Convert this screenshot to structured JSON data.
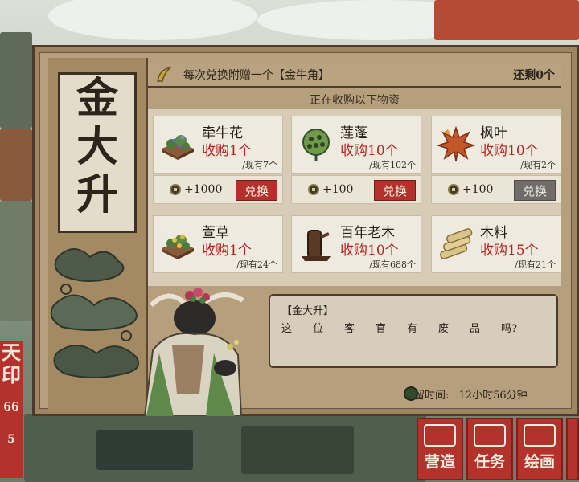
{
  "left_banner": {
    "char1": "天",
    "char2": "印",
    "number": "66",
    "char3": "5"
  },
  "merchant": {
    "name_chars": [
      "金",
      "大",
      "升"
    ]
  },
  "header": {
    "promo": "每次兑换附赠一个【金牛角】",
    "remaining": "还剩0个"
  },
  "subtitle": "正在收购以下物资",
  "items": [
    {
      "name": "牵牛花",
      "buy": "收购1个",
      "stock": "/现有7个",
      "reward": "+1000",
      "button": "兑换",
      "enabled": true,
      "icon": "morning-glory-icon"
    },
    {
      "name": "莲蓬",
      "buy": "收购10个",
      "stock": "/现有102个",
      "reward": "+100",
      "button": "兑换",
      "enabled": true,
      "icon": "lotus-pod-icon"
    },
    {
      "name": "枫叶",
      "buy": "收购10个",
      "stock": "/现有2个",
      "reward": "+100",
      "button": "兑换",
      "enabled": false,
      "icon": "maple-leaf-icon"
    },
    {
      "name": "萱草",
      "buy": "收购1个",
      "stock": "/现有24个",
      "icon": "daylily-icon"
    },
    {
      "name": "百年老木",
      "buy": "收购10个",
      "stock": "/现有688个",
      "icon": "old-wood-icon"
    },
    {
      "name": "木料",
      "buy": "收购15个",
      "stock": "/现有21个",
      "icon": "lumber-icon"
    }
  ],
  "dialog": {
    "speaker": "【金大升】",
    "line": "这——位——客——官——有——废——品——吗?"
  },
  "stay": {
    "label": "停留时间:",
    "value": "12小时56分钟"
  },
  "bottom_buttons": [
    {
      "label": "营造"
    },
    {
      "label": "任务"
    },
    {
      "label": "绘画"
    }
  ],
  "colors": {
    "accent_red": "#b3322c",
    "panel": "#b69f7c",
    "card": "#efeae0",
    "disabled": "#6e6d68"
  }
}
